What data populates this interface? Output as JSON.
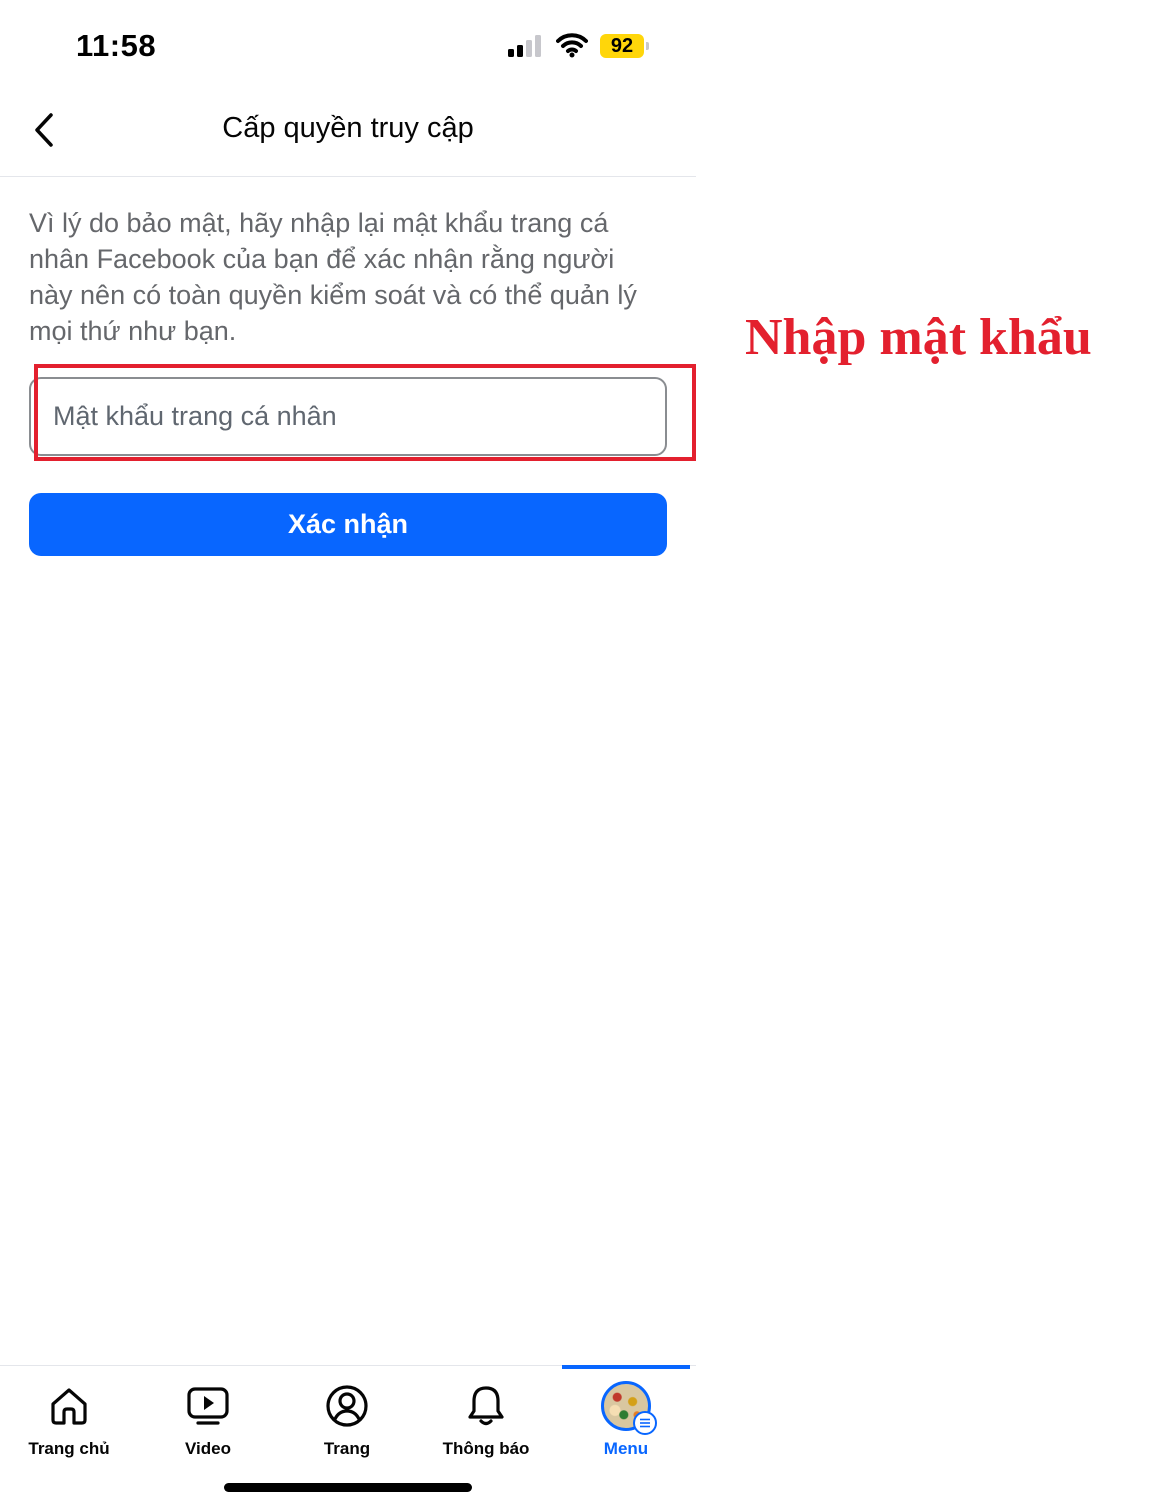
{
  "status_bar": {
    "time": "11:58",
    "battery_level": "92",
    "icons": [
      "cellular-signal-icon",
      "wifi-icon",
      "battery-icon"
    ]
  },
  "header": {
    "title": "Cấp quyền truy cập",
    "back_icon": "chevron-left-icon"
  },
  "content": {
    "description": "Vì lý do bảo mật, hãy nhập lại mật khẩu trang cá nhân Facebook của bạn để xác nhận rằng người này nên có toàn quyền kiểm soát và có thể quản lý mọi thứ như bạn.",
    "password_input": {
      "placeholder": "Mật khẩu trang cá nhân",
      "value": ""
    },
    "confirm_label": "Xác nhận"
  },
  "annotation": {
    "text": "Nhập mật khẩu",
    "color": "#e3202e"
  },
  "bottom_nav": {
    "items": [
      {
        "label": "Trang chủ",
        "icon": "home-icon",
        "active": false
      },
      {
        "label": "Video",
        "icon": "video-icon",
        "active": false
      },
      {
        "label": "Trang",
        "icon": "profile-icon",
        "active": false
      },
      {
        "label": "Thông báo",
        "icon": "bell-icon",
        "active": false
      },
      {
        "label": "Menu",
        "icon": "avatar-menu-icon",
        "active": true
      }
    ]
  },
  "colors": {
    "accent": "#0866ff",
    "battery": "#ffd60a",
    "text_secondary": "#65676b"
  }
}
